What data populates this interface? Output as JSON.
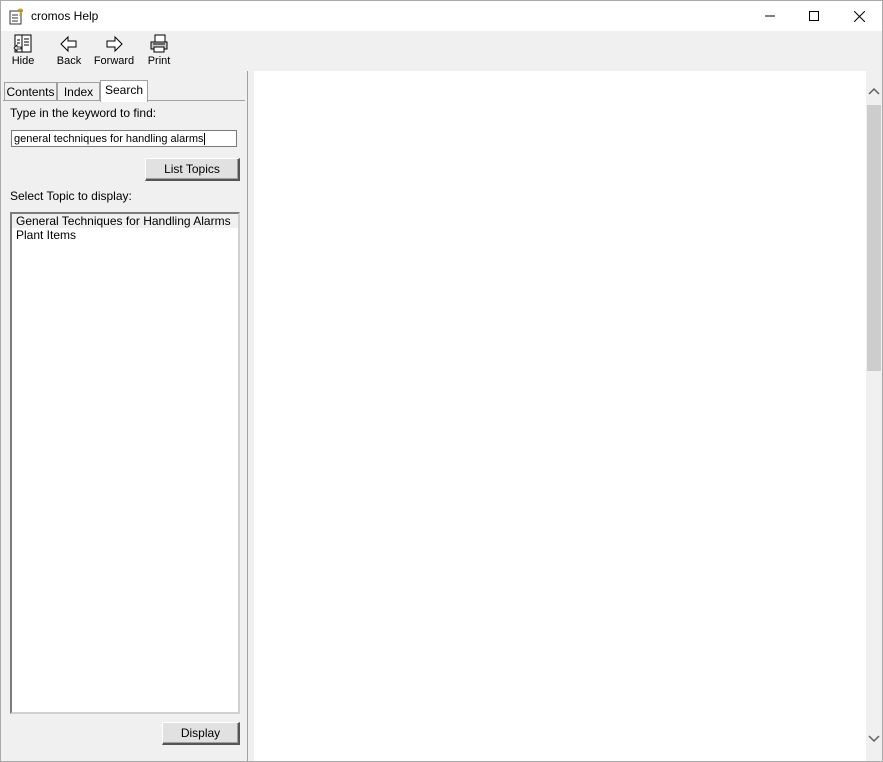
{
  "window": {
    "title": "cromos Help"
  },
  "toolbar": {
    "hide_label": "Hide",
    "back_label": "Back",
    "forward_label": "Forward",
    "print_label": "Print"
  },
  "tabs": [
    {
      "label": "Contents"
    },
    {
      "label": "Index"
    },
    {
      "label": "Search"
    }
  ],
  "search": {
    "keyword_prompt": "Type in the keyword to find:",
    "keyword_value": "general techniques for handling alarms",
    "list_topics_label": "List Topics",
    "select_prompt": "Select Topic to display:",
    "topics": [
      "General Techniques for Handling Alarms",
      "Plant Items"
    ],
    "display_label": "Display"
  }
}
